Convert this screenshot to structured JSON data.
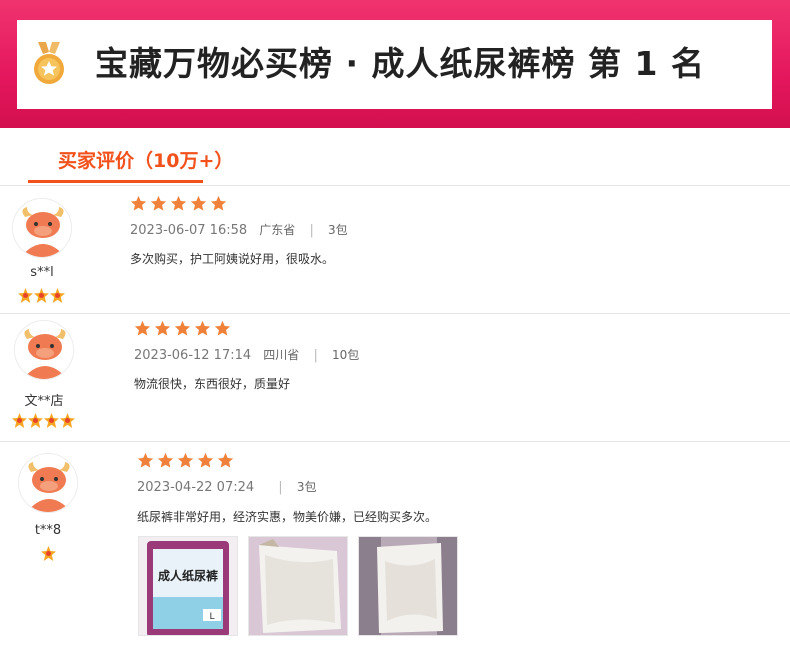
{
  "banner": {
    "title": "宝藏万物必买榜 · 成人纸尿裤榜 第 1 名",
    "icon": "medal-icon",
    "colors": {
      "banner": "#e4175d",
      "accent": "#f2511b",
      "star": "#f0813a"
    }
  },
  "tabs": [
    {
      "label": "买家评价（10万+）",
      "active": true
    }
  ],
  "reviews": [
    {
      "user": "s**l",
      "badge_count": 3,
      "rating": 5,
      "date": "2023-06-07 16:58",
      "location": "广东省",
      "quantity": "3包",
      "text": "多次购买，护工阿姨说好用，很吸水。",
      "photos": []
    },
    {
      "user": "文**店",
      "badge_count": 4,
      "rating": 5,
      "date": "2023-06-12 17:14",
      "location": "四川省",
      "quantity": "10包",
      "text": "物流很快，东西很好，质量好",
      "photos": []
    },
    {
      "user": "t**8",
      "badge_count": 1,
      "rating": 5,
      "date": "2023-04-22 07:24",
      "location": "",
      "quantity": "3包",
      "text": "纸尿裤非常好用，经济实惠，物美价嫌，已经购买多次。",
      "photos": [
        {
          "label": "成人纸尿裤",
          "size_tag": "L"
        },
        {
          "label": ""
        },
        {
          "label": ""
        }
      ]
    }
  ]
}
